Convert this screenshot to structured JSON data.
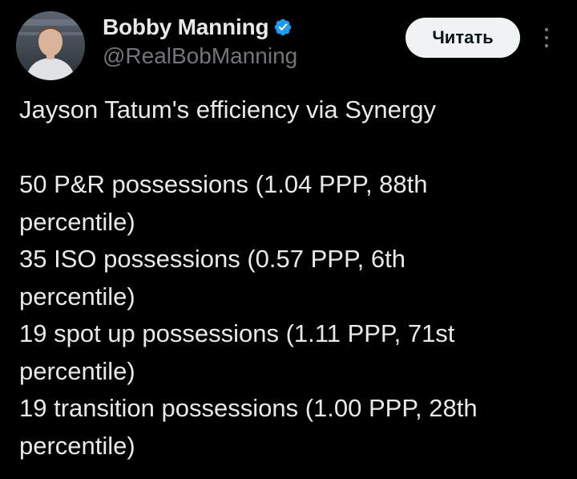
{
  "author": {
    "display_name": "Bobby Manning",
    "handle": "@RealBobManning",
    "verified": true
  },
  "follow_button": {
    "label": "Читать"
  },
  "icons": {
    "verified": "verified-badge-icon",
    "more": "more-options-icon"
  },
  "colors": {
    "background": "#000000",
    "text_primary": "#e7e9ea",
    "text_secondary": "#71767b",
    "verified_badge": "#1d9bf0",
    "follow_button_bg": "#eff3f4"
  },
  "tweet": {
    "headline": "Jayson Tatum's efficiency via Synergy",
    "stats": [
      {
        "first": "50 P&R possessions (1.04 PPP, 88th",
        "second": "percentile)"
      },
      {
        "first": "35 ISO possessions (0.57 PPP, 6th",
        "second": "percentile)"
      },
      {
        "first": "19 spot up possessions (1.11 PPP, 71st",
        "second": "percentile)"
      },
      {
        "first": "19 transition possessions (1.00 PPP, 28th",
        "second": "percentile)"
      }
    ]
  }
}
